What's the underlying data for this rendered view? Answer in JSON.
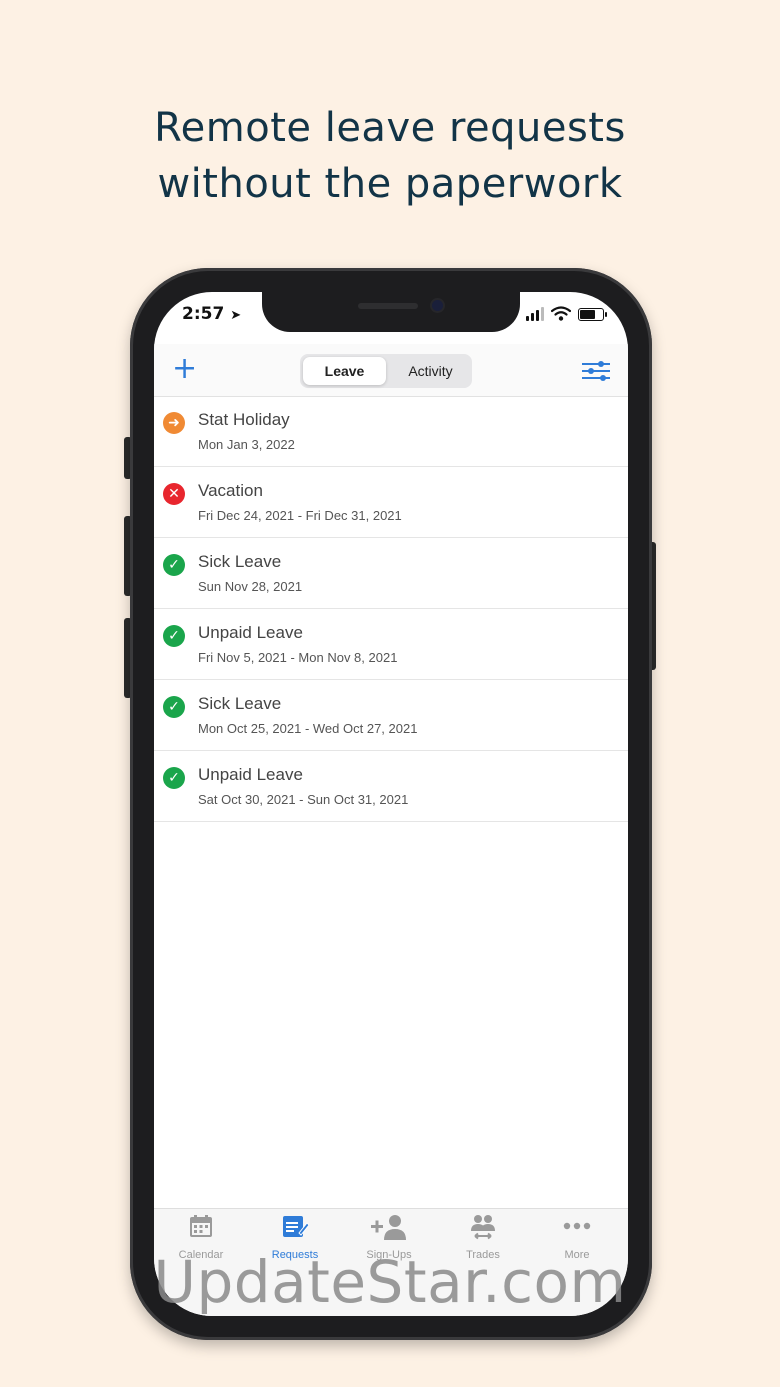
{
  "headline": {
    "line1": "Remote leave requests",
    "line2": "without the paperwork"
  },
  "status_bar": {
    "time": "2:57"
  },
  "header": {
    "add_icon": "plus-icon",
    "tabs": [
      {
        "label": "Leave"
      },
      {
        "label": "Activity"
      }
    ],
    "filter_icon": "sliders-icon"
  },
  "requests": [
    {
      "title": "Stat Holiday",
      "dates": "Mon Jan 3, 2022",
      "status": "pending",
      "glyph": "➜",
      "color": "#f08a34"
    },
    {
      "title": "Vacation",
      "dates": "Fri Dec 24, 2021 - Fri Dec 31, 2021",
      "status": "denied",
      "glyph": "✕",
      "color": "#e8262e"
    },
    {
      "title": "Sick Leave",
      "dates": "Sun Nov 28, 2021",
      "status": "approved",
      "glyph": "✓",
      "color": "#1aa54b"
    },
    {
      "title": "Unpaid Leave",
      "dates": "Fri Nov 5, 2021 - Mon Nov 8, 2021",
      "status": "approved",
      "glyph": "✓",
      "color": "#1aa54b"
    },
    {
      "title": "Sick Leave",
      "dates": "Mon Oct 25, 2021 - Wed Oct 27, 2021",
      "status": "approved",
      "glyph": "✓",
      "color": "#1aa54b"
    },
    {
      "title": "Unpaid Leave",
      "dates": "Sat Oct 30, 2021 - Sun Oct 31, 2021",
      "status": "approved",
      "glyph": "✓",
      "color": "#1aa54b"
    }
  ],
  "tabbar": [
    {
      "label": "Calendar",
      "icon": "calendar-icon"
    },
    {
      "label": "Requests",
      "icon": "requests-icon"
    },
    {
      "label": "Sign-Ups",
      "icon": "add-person-icon"
    },
    {
      "label": "Trades",
      "icon": "trades-icon"
    },
    {
      "label": "More",
      "icon": "more-icon"
    }
  ],
  "colors": {
    "accent": "#2f7cd8",
    "background": "#fdf1e4",
    "headline": "#123447"
  },
  "watermark": "UpdateStar.com"
}
